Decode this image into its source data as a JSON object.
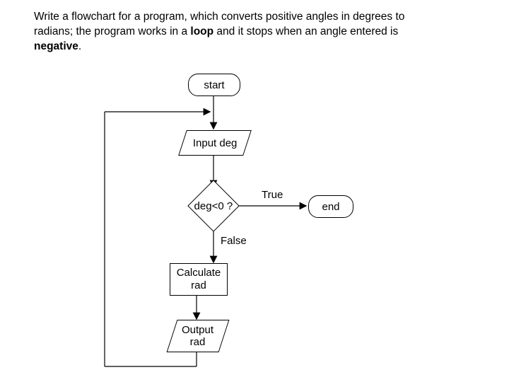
{
  "prompt": {
    "part1": "Write a flowchart for a program, which converts positive angles in degrees to radians; the program works in a ",
    "bold1": "loop",
    "part2": " and it stops when an angle entered is ",
    "bold2": "negative",
    "part3": "."
  },
  "flow": {
    "start": "start",
    "input": "Input deg",
    "decision": "deg<0 ?",
    "true_label": "True",
    "false_label": "False",
    "calc": "Calculate rad",
    "output": "Output rad",
    "end": "end"
  }
}
